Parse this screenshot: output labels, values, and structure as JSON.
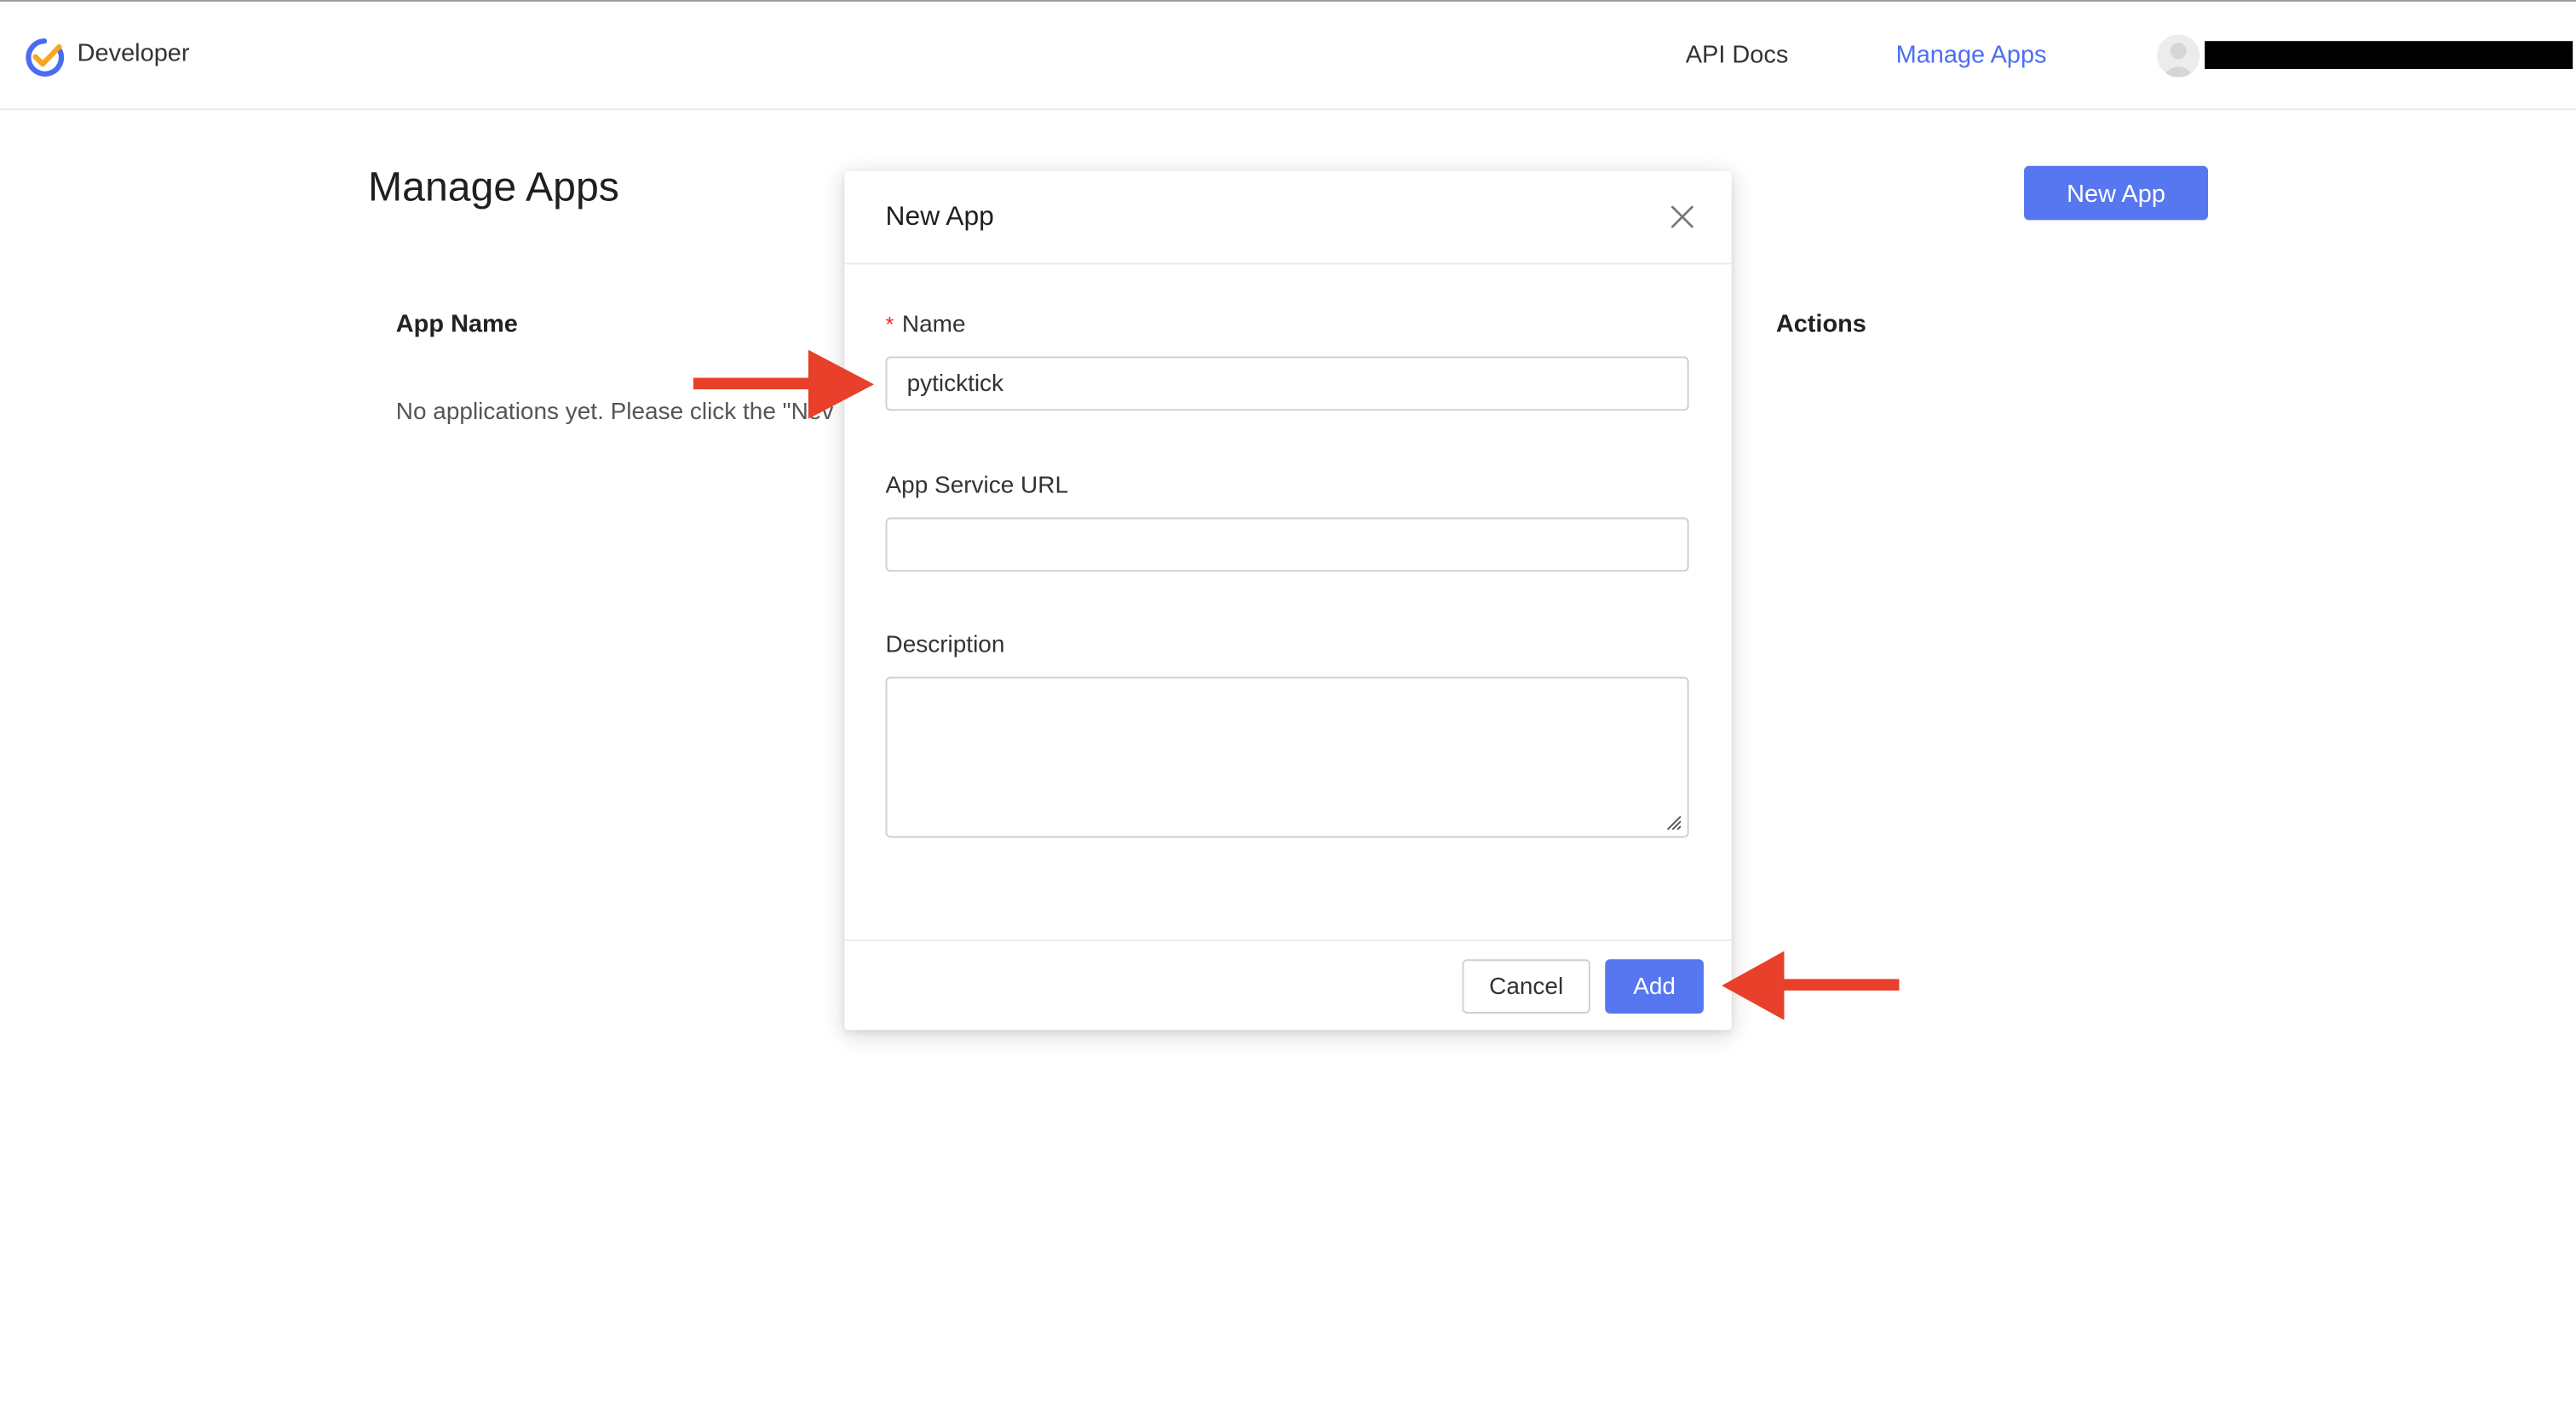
{
  "header": {
    "brand": "Developer",
    "nav": [
      {
        "label": "API Docs",
        "active": false
      },
      {
        "label": "Manage Apps",
        "active": true
      }
    ],
    "user_name": "[redacted]"
  },
  "page": {
    "title": "Manage Apps",
    "new_app_label": "New App",
    "table": {
      "columns": [
        "App Name",
        "Actions"
      ],
      "empty_text": "No applications yet. Please click the \"Nev"
    }
  },
  "modal": {
    "title": "New App",
    "fields": {
      "name": {
        "label": "Name",
        "required_mark": "*",
        "value": "pyticktick"
      },
      "service_url": {
        "label": "App Service URL",
        "value": ""
      },
      "description": {
        "label": "Description",
        "value": ""
      }
    },
    "cancel_label": "Cancel",
    "add_label": "Add"
  },
  "colors": {
    "accent": "#5677ef",
    "link_active": "#4c6ef5",
    "annotation_arrow": "#e8402a",
    "required": "#f5222d"
  },
  "icons": [
    "ticktick-logo-icon",
    "avatar-icon",
    "close-icon",
    "resize-grip-icon",
    "annotation-arrow-icon"
  ]
}
